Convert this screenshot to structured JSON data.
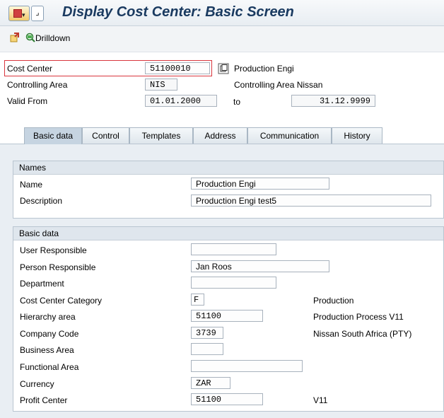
{
  "window": {
    "title": "Display Cost Center: Basic Screen"
  },
  "toolbar": {
    "drilldown_label": "Drilldown"
  },
  "header": {
    "cost_center_label": "Cost Center",
    "cost_center_value": "51100010",
    "cost_center_desc": "Production Engi",
    "controlling_area_label": "Controlling Area",
    "controlling_area_value": "NIS",
    "controlling_area_desc": "Controlling Area Nissan",
    "valid_from_label": "Valid From",
    "valid_from_value": "01.01.2000",
    "to_label": "to",
    "valid_to_value": "31.12.9999"
  },
  "tabs": [
    {
      "label": "Basic data"
    },
    {
      "label": "Control"
    },
    {
      "label": "Templates"
    },
    {
      "label": "Address"
    },
    {
      "label": "Communication"
    },
    {
      "label": "History"
    }
  ],
  "names_group": {
    "title": "Names",
    "name_label": "Name",
    "name_value": "Production Engi",
    "description_label": "Description",
    "description_value": "Production Engi test5"
  },
  "basic_group": {
    "title": "Basic data",
    "user_responsible_label": "User Responsible",
    "user_responsible_value": "",
    "person_responsible_label": "Person Responsible",
    "person_responsible_value": "Jan Roos",
    "department_label": "Department",
    "department_value": "",
    "category_label": "Cost Center Category",
    "category_value": "F",
    "category_desc": "Production",
    "hierarchy_label": "Hierarchy area",
    "hierarchy_value": "51100",
    "hierarchy_desc": "Production Process V11",
    "company_label": "Company Code",
    "company_value": "3739",
    "company_desc": "Nissan South Africa (PTY)",
    "business_area_label": "Business Area",
    "business_area_value": "",
    "functional_area_label": "Functional Area",
    "functional_area_value": "",
    "currency_label": "Currency",
    "currency_value": "ZAR",
    "profit_center_label": "Profit Center",
    "profit_center_value": "51100",
    "profit_center_desc": "V11"
  }
}
